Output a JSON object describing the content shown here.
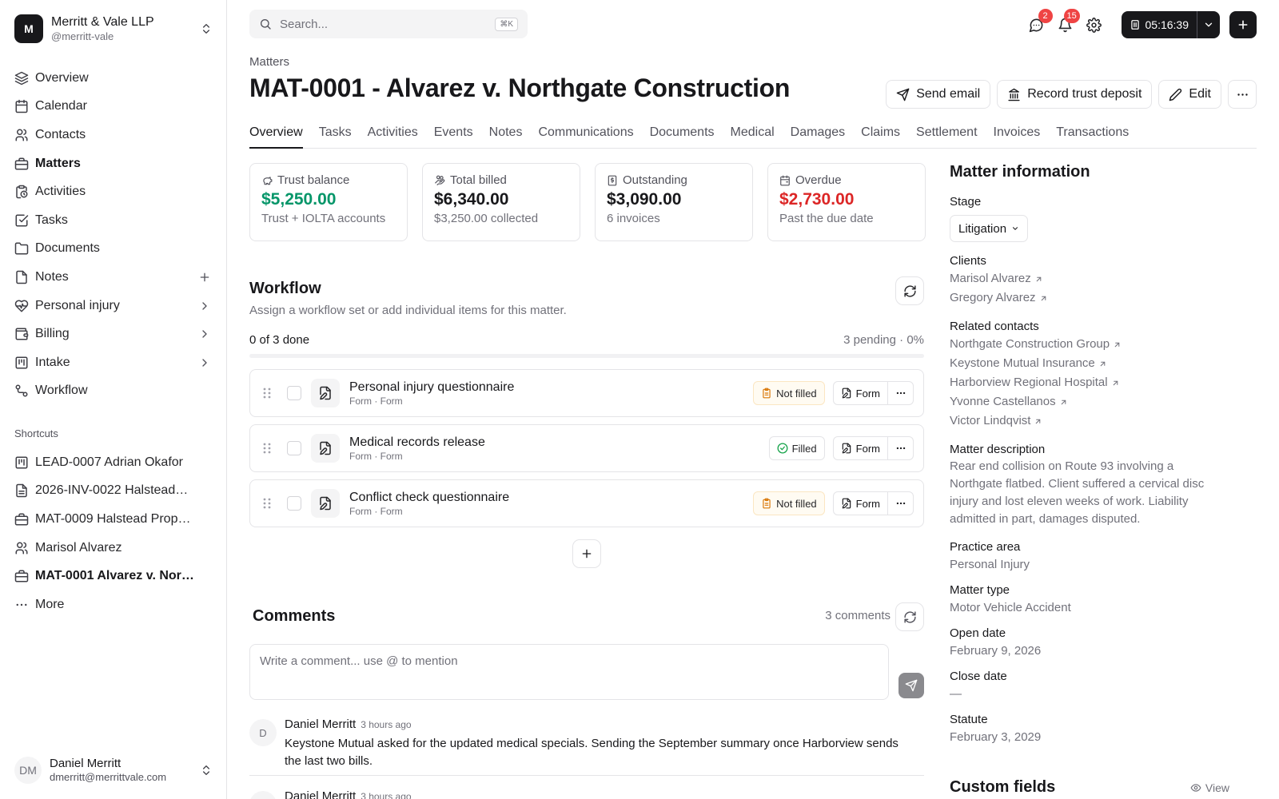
{
  "org": {
    "logo": "M",
    "name": "Merritt & Vale LLP",
    "handle": "@merritt-vale"
  },
  "nav": [
    {
      "label": "Overview",
      "icon": "layers-icon"
    },
    {
      "label": "Calendar",
      "icon": "calendar-icon"
    },
    {
      "label": "Contacts",
      "icon": "users-icon"
    },
    {
      "label": "Matters",
      "icon": "briefcase-icon"
    },
    {
      "label": "Activities",
      "icon": "clipboard-clock-icon"
    },
    {
      "label": "Tasks",
      "icon": "checkbox-icon"
    },
    {
      "label": "Documents",
      "icon": "folder-icon"
    },
    {
      "label": "Notes",
      "icon": "file-icon"
    },
    {
      "label": "Personal injury",
      "icon": "heart-pulse-icon"
    },
    {
      "label": "Billing",
      "icon": "wallet-icon"
    },
    {
      "label": "Intake",
      "icon": "kanban-icon"
    },
    {
      "label": "Workflow",
      "icon": "workflow-icon"
    }
  ],
  "shortcuts_title": "Shortcuts",
  "shortcuts": [
    {
      "label": "LEAD-0007 Adrian Okafor",
      "icon": "kanban-icon"
    },
    {
      "label": "2026-INV-0022 Halstead…",
      "icon": "receipt-icon"
    },
    {
      "label": "MAT-0009 Halstead Prop…",
      "icon": "briefcase-icon"
    },
    {
      "label": "Marisol Alvarez",
      "icon": "user-icon"
    },
    {
      "label": "MAT-0001 Alvarez v. Nor…",
      "icon": "briefcase-icon"
    },
    {
      "label": "More",
      "icon": "ellipsis-icon"
    }
  ],
  "user": {
    "initials": "DM",
    "name": "Daniel Merritt",
    "email": "dmerritt@merrittvale.com"
  },
  "search": {
    "placeholder": "Search...",
    "shortcut": "⌘K"
  },
  "badges": {
    "messages": "2",
    "notifications": "15"
  },
  "timer": "05:16:39",
  "breadcrumb": "Matters",
  "title": "MAT-0001 - Alvarez v. Northgate Construction",
  "actions": {
    "send_email": "Send email",
    "record_trust": "Record trust deposit",
    "edit": "Edit"
  },
  "tabs": [
    "Overview",
    "Tasks",
    "Activities",
    "Events",
    "Notes",
    "Communications",
    "Documents",
    "Medical",
    "Damages",
    "Claims",
    "Settlement",
    "Invoices",
    "Transactions"
  ],
  "cards": [
    {
      "label": "Trust balance",
      "value": "$5,250.00",
      "sub": "Trust + IOLTA accounts",
      "tone": "green",
      "icon": "piggy-bank-icon"
    },
    {
      "label": "Total billed",
      "value": "$6,340.00",
      "sub": "$3,250.00 collected",
      "tone": "default",
      "icon": "hand-coins-icon"
    },
    {
      "label": "Outstanding",
      "value": "$3,090.00",
      "sub": "6 invoices",
      "tone": "default",
      "icon": "receipt-icon"
    },
    {
      "label": "Overdue",
      "value": "$2,730.00",
      "sub": "Past the due date",
      "tone": "red",
      "icon": "calendar-alert-icon"
    }
  ],
  "workflow": {
    "title": "Workflow",
    "subtitle": "Assign a workflow set or add individual items for this matter.",
    "done": "0 of 3 done",
    "pending": "3 pending · 0%",
    "progress_fraction": 0,
    "items": [
      {
        "name": "Personal injury questionnaire",
        "type": "Form · Form",
        "status": "Not filled",
        "filled": false,
        "form_label": "Form"
      },
      {
        "name": "Medical records release",
        "type": "Form · Form",
        "status": "Filled",
        "filled": true,
        "form_label": "Form"
      },
      {
        "name": "Conflict check questionnaire",
        "type": "Form · Form",
        "status": "Not filled",
        "filled": false,
        "form_label": "Form"
      }
    ]
  },
  "comments": {
    "title": "Comments",
    "count": "3 comments",
    "placeholder": "Write a comment... use @ to mention",
    "items": [
      {
        "initial": "D",
        "author": "Daniel Merritt",
        "time": "3 hours ago",
        "body": "Keystone Mutual asked for the updated medical specials. Sending the September summary once Harborview sends the last two bills."
      },
      {
        "initial": "D",
        "author": "Daniel Merritt",
        "time": "3 hours ago",
        "body": ""
      }
    ]
  },
  "info": {
    "title": "Matter information",
    "stage_label": "Stage",
    "stage_value": "Litigation",
    "clients_label": "Clients",
    "clients": [
      "Marisol Alvarez",
      "Gregory Alvarez"
    ],
    "related_label": "Related contacts",
    "related": [
      "Northgate Construction Group",
      "Keystone Mutual Insurance",
      "Harborview Regional Hospital",
      "Yvonne Castellanos",
      "Victor Lindqvist"
    ],
    "description_label": "Matter description",
    "description": "Rear end collision on Route 93 involving a Northgate flatbed. Client suffered a cervical disc injury and lost eleven weeks of work. Liability admitted in part, damages disputed.",
    "practice_label": "Practice area",
    "practice": "Personal Injury",
    "type_label": "Matter type",
    "type": "Motor Vehicle Accident",
    "open_label": "Open date",
    "open": "February 9, 2026",
    "close_label": "Close date",
    "close": "—",
    "statute_label": "Statute",
    "statute": "February 3, 2029"
  },
  "custom_fields": {
    "title": "Custom fields",
    "view": "View"
  }
}
